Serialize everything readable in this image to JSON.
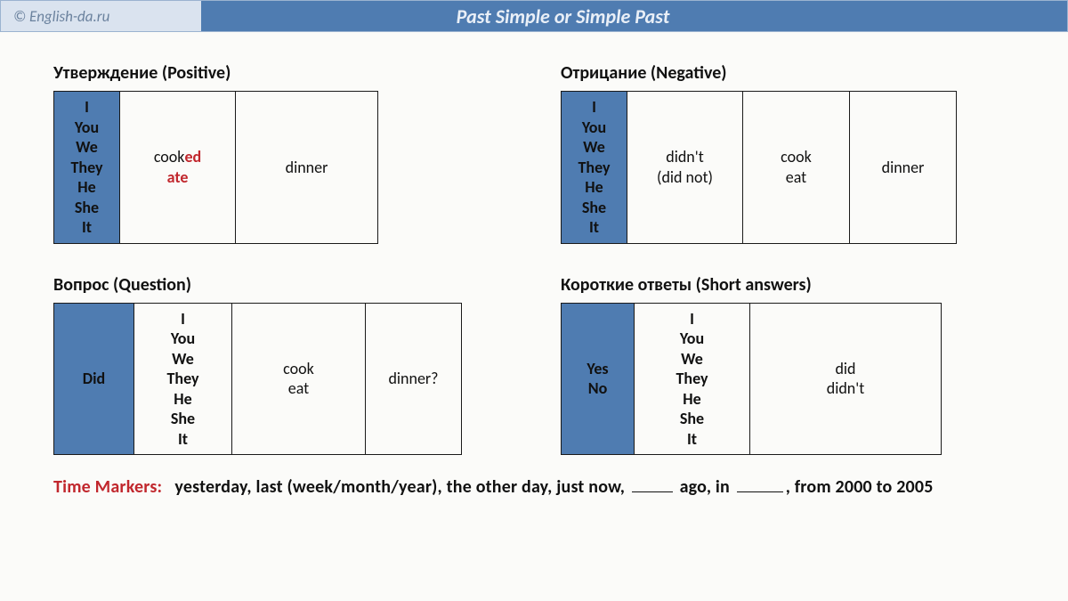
{
  "header": {
    "site": "© English-da.ru",
    "title": "Past Simple or Simple Past"
  },
  "sections": {
    "positive_title": "Утверждение (Positive)",
    "negative_title": "Отрицание (Negative)",
    "question_title": "Вопрос (Question)",
    "short_title": "Короткие ответы (Short answers)"
  },
  "pronouns": {
    "I": "I",
    "You": "You",
    "We": "We",
    "They": "They",
    "He": "He",
    "She": "She",
    "It": "It"
  },
  "positive": {
    "cook_stem": "cook",
    "cook_suffix": "ed",
    "ate": "ate",
    "dinner": "dinner"
  },
  "negative": {
    "didnt": "didn't",
    "didnot": "(did not)",
    "cook": "cook",
    "eat": "eat",
    "dinner": "dinner"
  },
  "question": {
    "did": "Did",
    "cook": "cook",
    "eat": "eat",
    "dinner": "dinner?"
  },
  "short": {
    "yes": "Yes",
    "no": "No",
    "did": "did",
    "didnt": "didn't"
  },
  "markers": {
    "label": "Time Markers:",
    "m1": "yesterday,",
    "m2": "last (week/month/year),",
    "m3": "the other day,",
    "m4": "just now,",
    "m5_suffix": "ago,",
    "m6_prefix": "in",
    "m6_suffix": ",",
    "m7": "from 2000 to 2005"
  }
}
